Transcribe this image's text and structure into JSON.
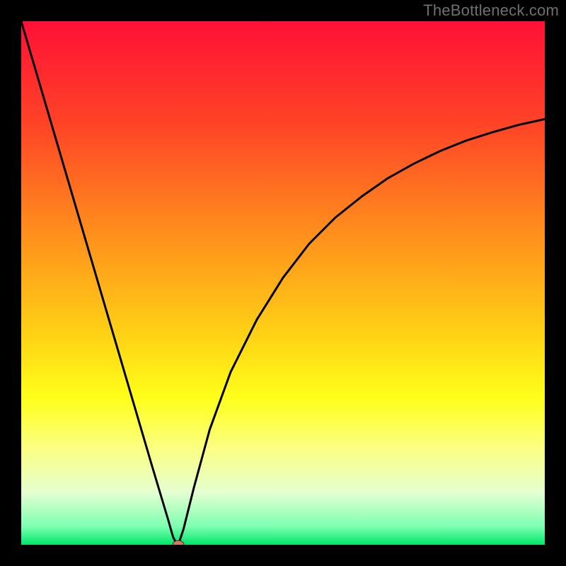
{
  "watermark": "TheBottleneck.com",
  "colors": {
    "background": "#000000",
    "curve": "#000000",
    "marker_fill": "#cf7a63",
    "marker_stroke": "#4a2b22",
    "gradient_stops": [
      {
        "offset": 0.0,
        "color": "#ff1036"
      },
      {
        "offset": 0.2,
        "color": "#ff4526"
      },
      {
        "offset": 0.4,
        "color": "#ff8d1d"
      },
      {
        "offset": 0.6,
        "color": "#ffd215"
      },
      {
        "offset": 0.72,
        "color": "#ffff1a"
      },
      {
        "offset": 0.82,
        "color": "#fbff86"
      },
      {
        "offset": 0.9,
        "color": "#e4ffd1"
      },
      {
        "offset": 0.965,
        "color": "#7dffb1"
      },
      {
        "offset": 1.0,
        "color": "#00e66a"
      }
    ]
  },
  "chart_data": {
    "type": "line",
    "title": "",
    "xlabel": "",
    "ylabel": "",
    "xlim": [
      0,
      100
    ],
    "ylim": [
      0,
      100
    ],
    "grid": false,
    "series": [
      {
        "name": "bottleneck-curve",
        "x": [
          0,
          5,
          10,
          15,
          20,
          25,
          28,
          29,
          29.5,
          30,
          31,
          33,
          36,
          40,
          45,
          50,
          55,
          60,
          65,
          70,
          75,
          80,
          85,
          90,
          95,
          100
        ],
        "y": [
          100,
          83,
          66,
          49,
          32,
          15,
          5,
          1.5,
          0.5,
          0,
          3,
          11,
          22,
          33,
          43,
          51,
          57.5,
          62.5,
          66.5,
          70,
          72.8,
          75.2,
          77.2,
          78.8,
          80.2,
          81.3
        ]
      }
    ],
    "marker": {
      "x": 30,
      "y": 0,
      "name": "optimal-point"
    }
  }
}
